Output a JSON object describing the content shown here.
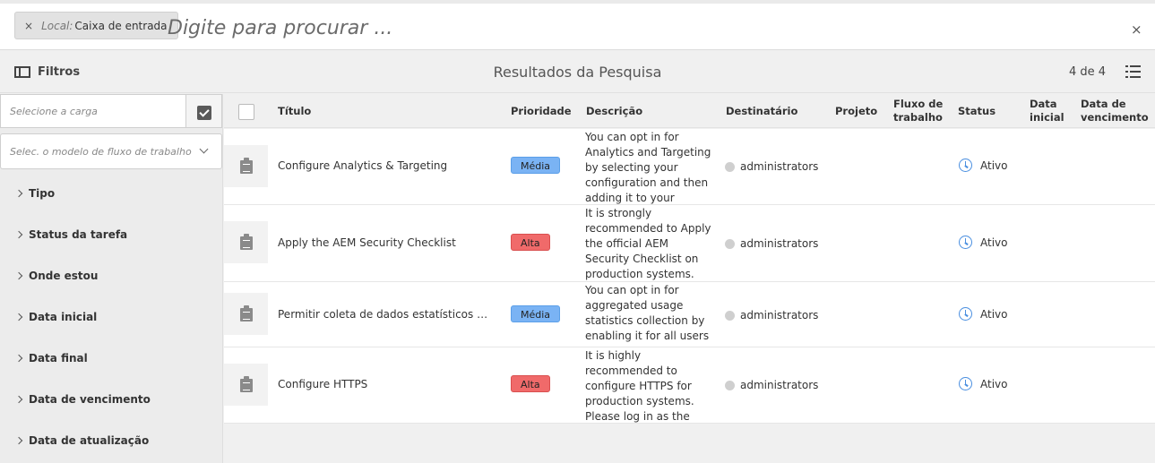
{
  "search": {
    "tag_key": "Local:",
    "tag_value": "Caixa de entrada",
    "tag_remove": "×",
    "placeholder": "Digite para procurar ...",
    "close": "×"
  },
  "subheader": {
    "filters_label": "Filtros",
    "results_title": "Resultados da Pesquisa",
    "count": "4 de 4"
  },
  "sidebar": {
    "cargo_placeholder": "Selecione a carga",
    "workflow_model_placeholder": "Selec. o modelo de fluxo de trabalho",
    "facets": [
      "Tipo",
      "Status da tarefa",
      "Onde estou",
      "Data inicial",
      "Data final",
      "Data de vencimento",
      "Data de atualização"
    ]
  },
  "table": {
    "headers": {
      "title": "Título",
      "priority": "Prioridade",
      "description": "Descrição",
      "assignee": "Destinatário",
      "project": "Projeto",
      "workflow_line1": "Fluxo de",
      "workflow_line2": "trabalho",
      "status": "Status",
      "start_line1": "Data",
      "start_line2": "inicial",
      "due_line1": "Data de",
      "due_line2": "vencimento"
    },
    "rows": [
      {
        "title": "Configure Analytics & Targeting",
        "priority": "Média",
        "description": "You can opt in for Analytics and Targeting by selecting your configuration and then adding it to your pages.",
        "assignee": "administrators",
        "status": "Ativo"
      },
      {
        "title": "Apply the AEM Security Checklist",
        "priority": "Alta",
        "description": "It is strongly recommended to Apply the official AEM Security Checklist on production systems. Please review",
        "assignee": "administrators",
        "status": "Ativo"
      },
      {
        "title": "Permitir coleta de dados estatísticos de uso...",
        "priority": "Média",
        "description": "You can opt in for aggregated usage statistics collection by enabling it for all users",
        "assignee": "administrators",
        "status": "Ativo"
      },
      {
        "title": "Configure HTTPS",
        "priority": "Alta",
        "description": "It is highly recommended to configure HTTPS for production systems. Please log in as the admin user and use the",
        "assignee": "administrators",
        "status": "Ativo"
      }
    ]
  },
  "colors": {
    "priority_media": "#7ab3f4",
    "priority_alta": "#f06a6a",
    "status_icon": "#4a8fe0"
  },
  "icons": {
    "filters": "sidebar-panel-icon",
    "view": "list-view-icon",
    "row": "clipboard-icon",
    "status": "clock-icon"
  }
}
